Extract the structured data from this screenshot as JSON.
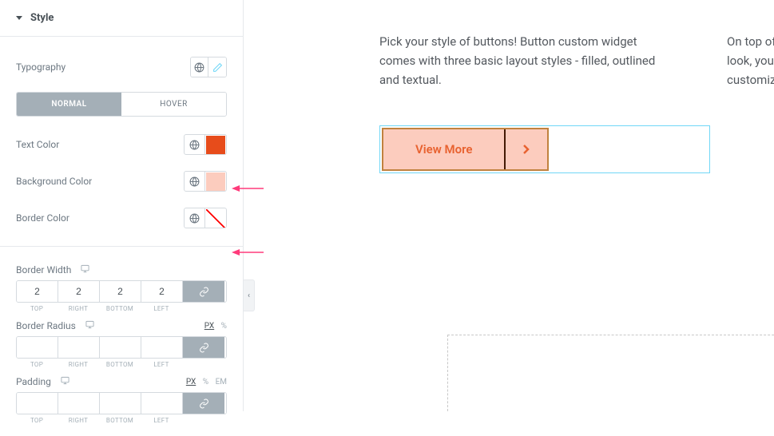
{
  "section": {
    "title": "Style"
  },
  "typography": {
    "label": "Typography"
  },
  "state_tabs": {
    "normal": "NORMAL",
    "hover": "HOVER"
  },
  "colors": {
    "text": {
      "label": "Text Color",
      "value": "#e74c1b"
    },
    "background": {
      "label": "Background Color",
      "value": "#fcccbe"
    },
    "border": {
      "label": "Border Color",
      "value": "transparent"
    }
  },
  "border_width": {
    "label": "Border Width",
    "top": "2",
    "right": "2",
    "bottom": "2",
    "left": "2",
    "labels": {
      "top": "TOP",
      "right": "RIGHT",
      "bottom": "BOTTOM",
      "left": "LEFT"
    }
  },
  "border_radius": {
    "label": "Border Radius",
    "top": "",
    "right": "",
    "bottom": "",
    "left": "",
    "units": {
      "px": "PX",
      "pct": "%"
    }
  },
  "padding": {
    "label": "Padding",
    "top": "",
    "right": "",
    "bottom": "",
    "left": "",
    "units": {
      "px": "PX",
      "pct": "%",
      "em": "EM"
    }
  },
  "preview": {
    "text1": "Pick your style of buttons! Button custom widget comes with three basic layout styles - filled, outlined and textual.",
    "text2": "On top of the basic button look, you also get to customize all of the standard",
    "button_label": "View More"
  }
}
